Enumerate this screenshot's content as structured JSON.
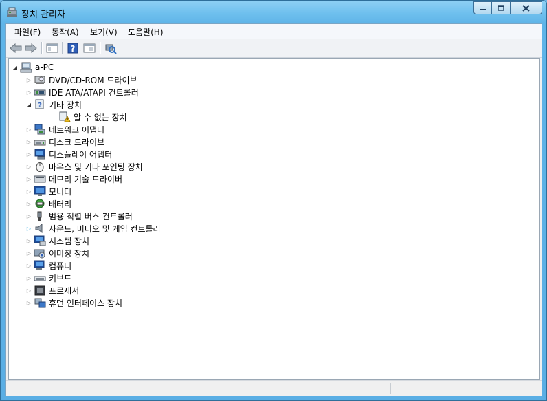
{
  "window": {
    "title": "장치 관리자"
  },
  "menu": [
    {
      "label": "파일(F)"
    },
    {
      "label": "동작(A)"
    },
    {
      "label": "보기(V)"
    },
    {
      "label": "도움말(H)"
    }
  ],
  "tree": {
    "root": "a-PC",
    "nodes": [
      {
        "label": "DVD/CD-ROM 드라이브",
        "icon": "dvd-drive-icon"
      },
      {
        "label": "IDE ATA/ATAPI 컨트롤러",
        "icon": "ide-controller-icon"
      },
      {
        "label": "기타 장치",
        "icon": "other-devices-icon",
        "expanded": true
      },
      {
        "label": "알 수 없는 장치",
        "icon": "unknown-device-warning-icon",
        "child": true
      },
      {
        "label": "네트워크 어댑터",
        "icon": "network-adapter-icon"
      },
      {
        "label": "디스크 드라이브",
        "icon": "disk-drive-icon"
      },
      {
        "label": "디스플레이 어댑터",
        "icon": "display-adapter-icon"
      },
      {
        "label": "마우스 및 기타 포인팅 장치",
        "icon": "mouse-icon"
      },
      {
        "label": "메모리 기술 드라이버",
        "icon": "memory-technology-icon"
      },
      {
        "label": "모니터",
        "icon": "monitor-icon"
      },
      {
        "label": "배터리",
        "icon": "battery-icon"
      },
      {
        "label": "범용 직렬 버스 컨트롤러",
        "icon": "usb-controller-icon"
      },
      {
        "label": "사운드, 비디오 및 게임 컨트롤러",
        "icon": "sound-icon",
        "hot": true
      },
      {
        "label": "시스템 장치",
        "icon": "system-devices-icon"
      },
      {
        "label": "이미징 장치",
        "icon": "imaging-device-icon"
      },
      {
        "label": "컴퓨터",
        "icon": "computer-icon"
      },
      {
        "label": "키보드",
        "icon": "keyboard-icon"
      },
      {
        "label": "프로세서",
        "icon": "processor-icon"
      },
      {
        "label": "휴먼 인터페이스 장치",
        "icon": "hid-icon"
      }
    ]
  },
  "toolbar": [
    "back-arrow-icon",
    "forward-arrow-icon",
    "show-hide-console-tree-icon",
    "help-icon",
    "properties-icon",
    "scan-hardware-icon"
  ],
  "colors": {
    "title_bar": "#6fc0ee",
    "warning": "#f0c020",
    "link_hot": "#2aa4dc"
  }
}
